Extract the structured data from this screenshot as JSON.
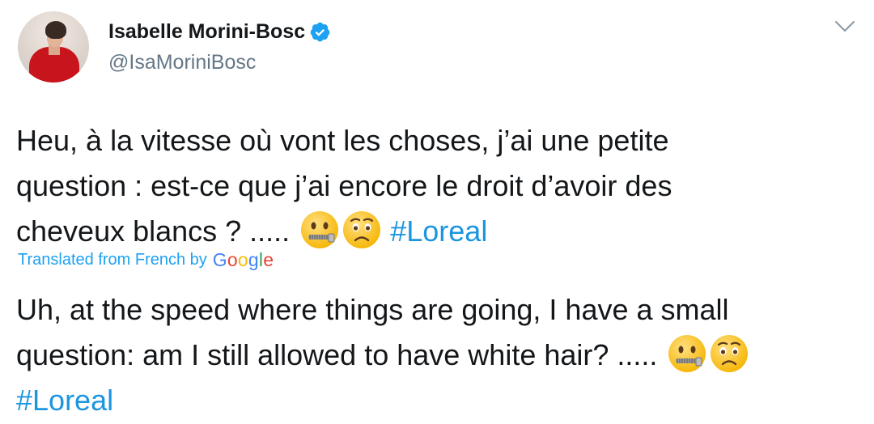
{
  "author": {
    "display_name": "Isabelle Morini-Bosc",
    "handle": "@IsaMoriniBosc",
    "verified": true
  },
  "tweet": {
    "line1": "Heu, à la vitesse où vont les choses, j’ai une  petite",
    "line2": "question : est-ce que j’ai encore le droit d’avoir des",
    "line3": "cheveux blancs ? .....",
    "emojis": [
      "zipper-mouth-face",
      "worried-face"
    ],
    "hashtag": "#Loreal"
  },
  "translation_notice": {
    "label": "Translated from French by",
    "provider": "Google"
  },
  "translation": {
    "line1": "Uh, at the speed where things are going, I have a small",
    "line2": "question: am I still allowed to have white hair? .....",
    "emojis": [
      "zipper-mouth-face",
      "worried-face"
    ],
    "hashtag": "#Loreal"
  },
  "colors": {
    "link": "#1b95e0",
    "secondary_text": "#657786",
    "verified_badge": "#1da1f2"
  }
}
